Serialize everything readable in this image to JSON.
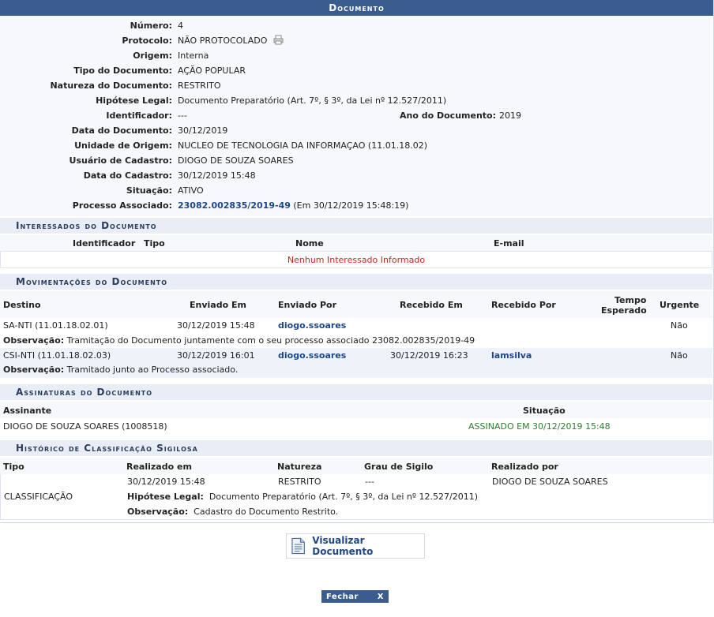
{
  "panel": {
    "title": "Documento"
  },
  "info": {
    "numero": {
      "label": "Número:",
      "value": "4"
    },
    "protocolo": {
      "label": "Protocolo:",
      "value": "NÃO PROTOCOLADO"
    },
    "origem": {
      "label": "Origem:",
      "value": "Interna"
    },
    "tipo": {
      "label": "Tipo do Documento:",
      "value": "AÇÃO POPULAR"
    },
    "natureza": {
      "label": "Natureza do Documento:",
      "value": "RESTRITO"
    },
    "hipotese": {
      "label": "Hipótese Legal:",
      "value": "Documento Preparatório (Art. 7º, § 3º, da Lei nº 12.527/2011)"
    },
    "identificador": {
      "label": "Identificador:",
      "value": "---"
    },
    "ano": {
      "label": "Ano do Documento:",
      "value": "2019"
    },
    "data_documento": {
      "label": "Data do Documento:",
      "value": "30/12/2019"
    },
    "unidade": {
      "label": "Unidade de Origem:",
      "value": "NUCLEO DE TECNOLOGIA DA INFORMAÇAO (11.01.18.02)"
    },
    "usuario": {
      "label": "Usuário de Cadastro:",
      "value": "DIOGO DE SOUZA SOARES"
    },
    "data_cadastro": {
      "label": "Data do Cadastro:",
      "value": "30/12/2019 15:48"
    },
    "situacao": {
      "label": "Situação:",
      "value": "ATIVO"
    },
    "processo": {
      "label": "Processo Associado:",
      "link": "23082.002835/2019-49",
      "suffix": "(Em 30/12/2019 15:48:19)"
    }
  },
  "interessados": {
    "title": "Interessados do Documento",
    "headers": {
      "identificador": "Identificador",
      "tipo": "Tipo",
      "nome": "Nome",
      "email": "E-mail"
    },
    "empty": "Nenhum Interessado Informado"
  },
  "movimentacoes": {
    "title": "Movimentações do Documento",
    "headers": {
      "destino": "Destino",
      "enviado_em": "Enviado Em",
      "enviado_por": "Enviado Por",
      "recebido_em": "Recebido Em",
      "recebido_por": "Recebido Por",
      "tempo_l1": "Tempo",
      "tempo_l2": "Esperado",
      "urgente": "Urgente"
    },
    "obs_label": "Observação:",
    "rows": [
      {
        "destino": "SA-NTI (11.01.18.02.01)",
        "enviado_em": "30/12/2019 15:48",
        "enviado_por": "diogo.ssoares",
        "recebido_em": "",
        "recebido_por": "",
        "urgente": "Não",
        "obs": "Tramitação do Documento juntamente com o seu processo associado 23082.002835/2019-49"
      },
      {
        "destino": "CSI-NTI (11.01.18.02.03)",
        "enviado_em": "30/12/2019 16:01",
        "enviado_por": "diogo.ssoares",
        "recebido_em": "30/12/2019 16:23",
        "recebido_por": "lamsilva",
        "urgente": "Não",
        "obs": "Tramitado junto ao Processo associado."
      }
    ]
  },
  "assinaturas": {
    "title": "Assinaturas do Documento",
    "headers": {
      "assinante": "Assinante",
      "situacao": "Situação"
    },
    "rows": [
      {
        "assinante": "DIOGO DE SOUZA SOARES (1008518)",
        "situacao": "ASSINADO EM 30/12/2019 15:48"
      }
    ]
  },
  "historico": {
    "title": "Histórico de Classificação Sigilosa",
    "headers": {
      "tipo": "Tipo",
      "realizado_em": "Realizado em",
      "natureza": "Natureza",
      "grau": "Grau de Sigilo",
      "realizado_por": "Realizado por"
    },
    "row": {
      "tipo": "CLASSIFICAÇÃO",
      "realizado_em": "30/12/2019 15:48",
      "natureza": "RESTRITO",
      "grau": "---",
      "realizado_por": "DIOGO DE SOUZA SOARES",
      "hipotese_label": "Hipótese Legal:",
      "hipotese": "Documento Preparatório (Art. 7º, § 3º, da Lei nº 12.527/2011)",
      "obs_label": "Observação:",
      "obs": "Cadastro do Documento Restrito."
    }
  },
  "actions": {
    "visualizar": "Visualizar Documento",
    "fechar": "Fechar",
    "fechar_x": "X"
  },
  "icons": {
    "protocolo": "printer-icon",
    "visualizar": "document-icon",
    "close": "close-icon"
  },
  "colors": {
    "header": "#3b5c8f",
    "link": "#1f4788",
    "empty": "#cc2222",
    "signed": "#2e7d32"
  }
}
